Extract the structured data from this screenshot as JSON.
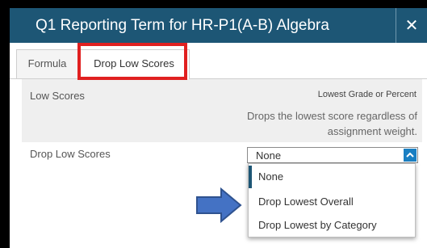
{
  "dialog": {
    "title": "Q1 Reporting Term for HR-P1(A-B) Algebra",
    "close_label": "✕"
  },
  "tabs": [
    {
      "label": "Formula",
      "active": false
    },
    {
      "label": "Drop Low Scores",
      "active": true
    }
  ],
  "info": {
    "heading": "Low Scores",
    "basis": "Lowest Grade or Percent",
    "description": "Drops the lowest score regardless of assignment weight."
  },
  "field": {
    "label": "Drop Low Scores",
    "selected": "None",
    "options": [
      "None",
      "Drop Lowest Overall",
      "Drop Lowest by Category"
    ]
  },
  "colors": {
    "titlebar": "#1d5675",
    "highlight": "#e02020",
    "arrow_fill": "#4472c4",
    "select_toggle": "#1a7fc2"
  },
  "annotations": {
    "highlight_box_icon": "red-highlight-box",
    "pointer_icon": "blue-arrow-icon"
  }
}
